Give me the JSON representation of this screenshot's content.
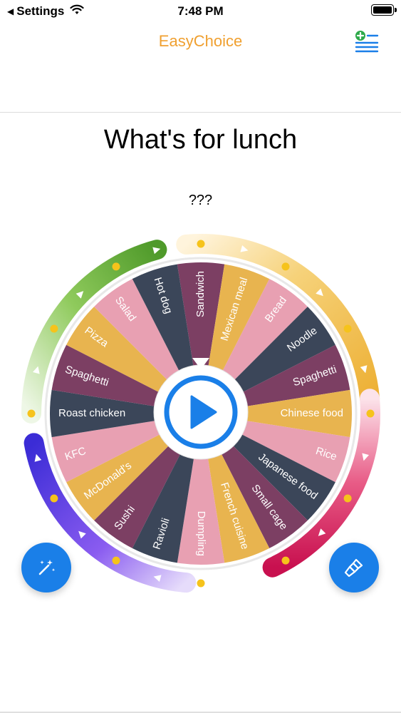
{
  "status_bar": {
    "back_label": "Settings",
    "time": "7:48 PM"
  },
  "nav": {
    "title": "EasyChoice",
    "add_icon": "list-add-icon"
  },
  "wheel_title": "What's for lunch",
  "result_text": "???",
  "colors": {
    "title_accent": "#f0a030",
    "play_blue": "#1a7fe8",
    "segments": [
      "#e8a0b2",
      "#3b4659",
      "#7c3f63",
      "#e8b44f"
    ]
  },
  "wheel": {
    "options": [
      "Sandwich",
      "Mexican meal",
      "Bread",
      "Noodle",
      "Spaghetti",
      "Chinese food",
      "Rice",
      "Japanese food",
      "Small cage",
      "French cuisine",
      "Dumpling",
      "Ravioli",
      "Sushi",
      "McDonald's",
      "KFC",
      "Roast chicken",
      "Spaghetti",
      "Pizza",
      "Salad",
      "Hot dog"
    ]
  },
  "buttons": {
    "magic": "magic-wand-icon",
    "brush": "brush-icon"
  }
}
